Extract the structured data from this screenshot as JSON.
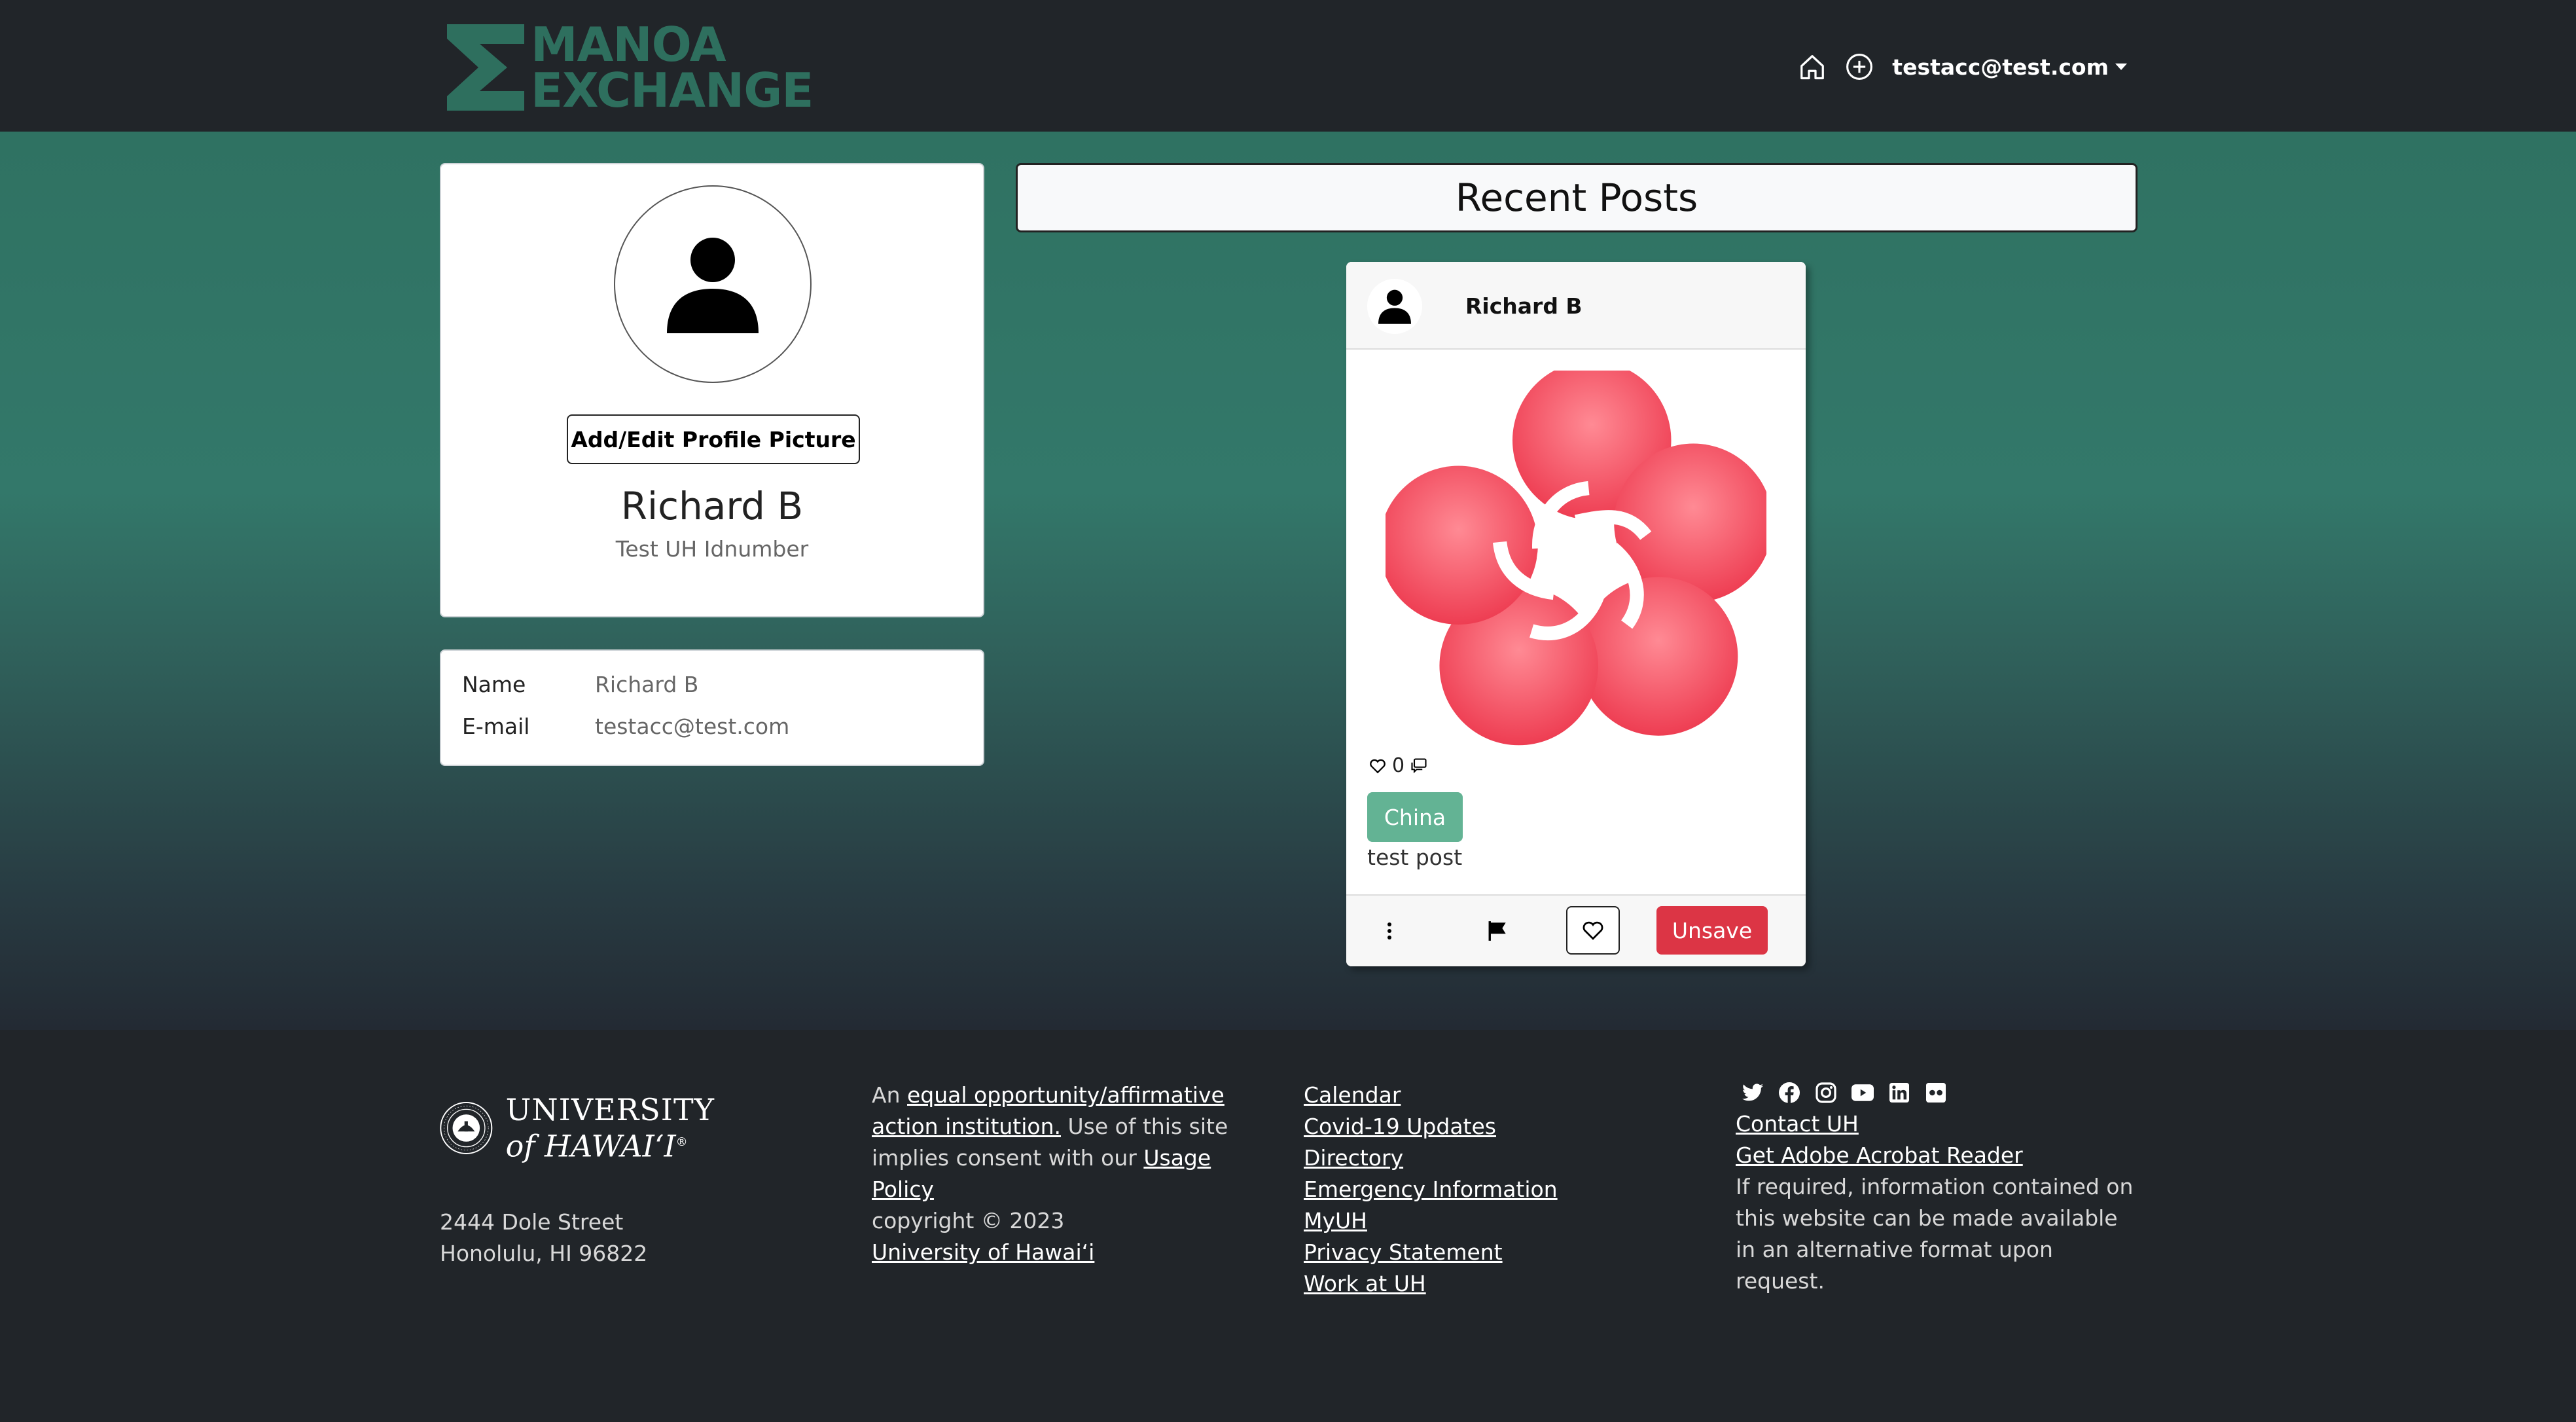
{
  "navbar": {
    "logo_line1": "MANOA",
    "logo_line2": "EXCHANGE",
    "user_email": "testacc@test.com",
    "icons": [
      "house-icon",
      "plus-circle-icon"
    ]
  },
  "profile": {
    "edit_picture_label": "Add/Edit Profile Picture",
    "name": "Richard B",
    "id_text": "Test UH Idnumber"
  },
  "info": {
    "name_label": "Name",
    "name_value": "Richard B",
    "email_label": "E-mail",
    "email_value": "testacc@test.com"
  },
  "recent": {
    "title": "Recent Posts"
  },
  "post": {
    "author": "Richard B",
    "like_count": "0",
    "tag": "China",
    "text": "test post",
    "unsave_label": "Unsave"
  },
  "footer": {
    "uh_line1": "UNIVERSITY",
    "uh_line2": "of HAWAIʻI",
    "uh_registered": "®",
    "address_line1": "2444 Dole Street",
    "address_line2": "Honolulu, HI 96822",
    "col2_prefix": "An",
    "col2_link1": "equal opportunity/affirmative action institution.",
    "col2_mid": "Use of this site implies consent with our",
    "col2_link2": "Usage Policy",
    "col2_copyright": "copyright © 2023",
    "col2_link3": "University of Hawaiʻi",
    "links": [
      "Calendar",
      "Covid-19 Updates",
      "Directory",
      "Emergency Information",
      "MyUH",
      "Privacy Statement",
      "Work at UH"
    ],
    "contact_label": "Contact UH",
    "acrobat_label": "Get Adobe Acrobat Reader",
    "accessibility_text": "If required, information contained on this website can be made available in an alternative format upon request.",
    "social_icons": [
      "twitter-icon",
      "facebook-icon",
      "instagram-icon",
      "youtube-icon",
      "linkedin-icon",
      "flickr-icon"
    ]
  },
  "colors": {
    "brand_green": "#2e6f5e",
    "tag_green": "#63b394",
    "danger": "#dc3545",
    "dark": "#212529"
  }
}
